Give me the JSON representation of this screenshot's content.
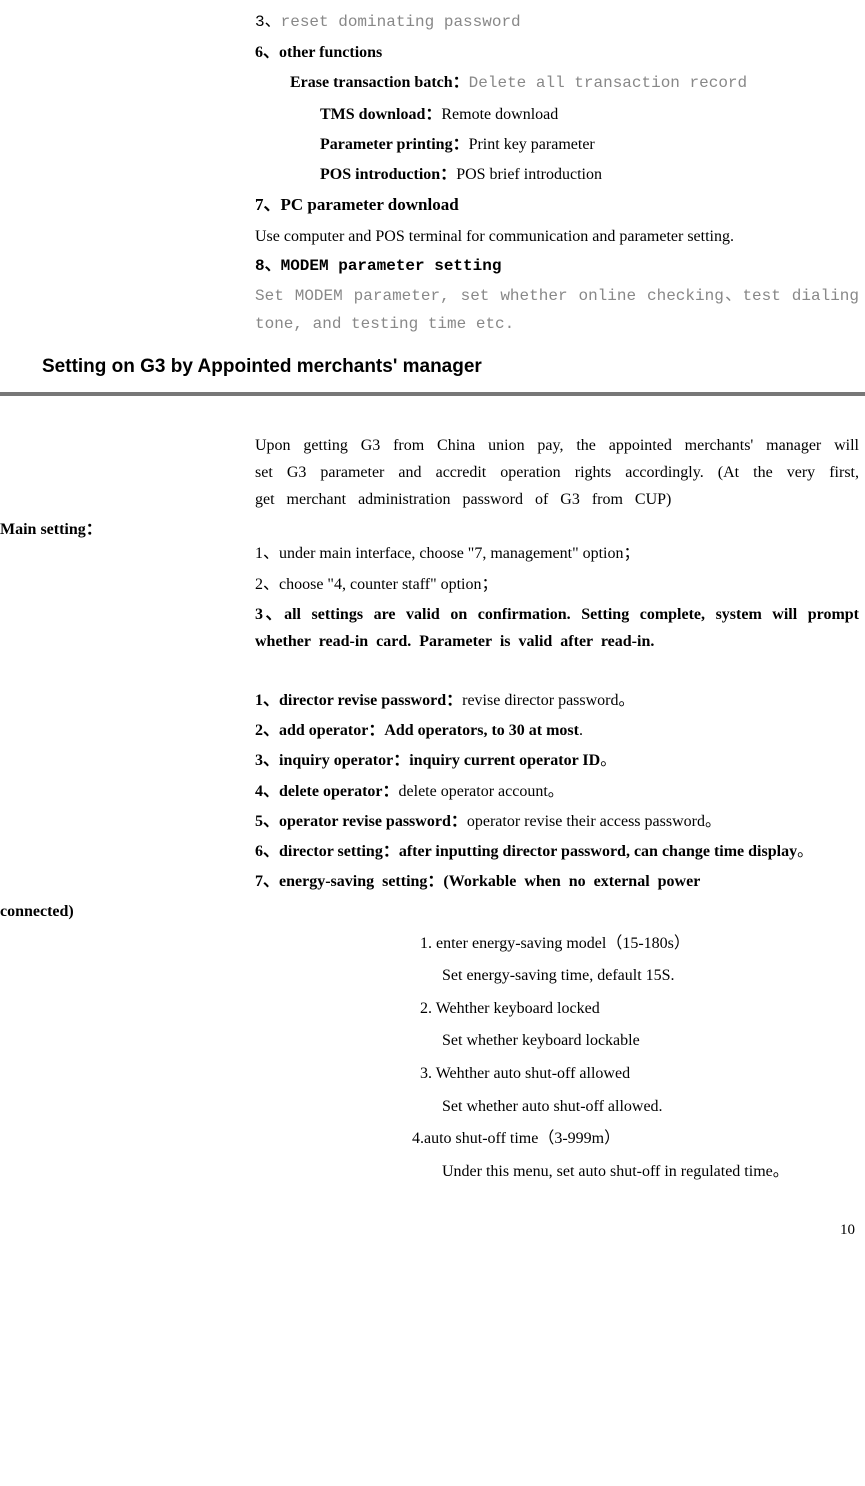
{
  "top": {
    "l3": {
      "num": "3、",
      "txt": "reset dominating password"
    },
    "l6": "6、other functions",
    "erase_label": "Erase transaction batch：",
    "erase_txt": "Delete all transaction record",
    "tms_label": "TMS download：",
    "tms_txt": "Remote download",
    "param_label": "Parameter printing：",
    "param_txt": "Print key parameter",
    "pos_label": "POS introduction：",
    "pos_txt": "POS brief introduction",
    "l7": "7、PC parameter download",
    "l7_txt": "Use computer and POS terminal for communication and parameter setting.",
    "l8": "8、MODEM parameter setting",
    "l8_txt": "Set MODEM parameter, set whether online checking、test  dialing tone, and testing time etc."
  },
  "heading": "Setting on G3 by Appointed merchants' manager",
  "intro": "Upon getting G3 from China union pay, the appointed merchants' manager will set G3 parameter and accredit operation rights accordingly. (At the very first, get merchant administration password of G3 from CUP)",
  "main_setting_label": "Main setting：",
  "steps": {
    "s1": "1、under main interface, choose \"7, management\" option；",
    "s2": "2、choose \"4, counter staff\" option；",
    "s3": "3、all settings are valid on confirmation. Setting complete, system will prompt whether read-in card. Parameter is valid after read-in."
  },
  "items": {
    "i1_b": "1、director revise password：",
    "i1_r": "revise director password。",
    "i2_b": "2、add operator：Add operators, to 30 at most",
    "i2_r": ".",
    "i3_b": "3、inquiry operator：inquiry current operator ID",
    "i3_r": "。",
    "i4_b": "4、delete operator：",
    "i4_r": "delete operator account。",
    "i5_b": "5、operator revise password：",
    "i5_r": "operator revise their access password。",
    "i6_b": "6、director setting：after inputting director password, can change time display",
    "i6_r": "。",
    "i7_b": "7、energy-saving setting：(Workable when no external power connected)"
  },
  "energy": {
    "e1": "1. enter energy-saving model（15-180s）",
    "e1s": "Set energy-saving time, default 15S.",
    "e2": "2. Wehther keyboard locked",
    "e2s": "Set whether keyboard lockable",
    "e3": "3. Wehther auto shut-off allowed",
    "e3s": "Set whether auto shut-off allowed.",
    "e4": "4.auto shut-off time（3-999m）",
    "e4s": "Under this menu, set auto shut-off in regulated time。"
  },
  "page_num": "10"
}
